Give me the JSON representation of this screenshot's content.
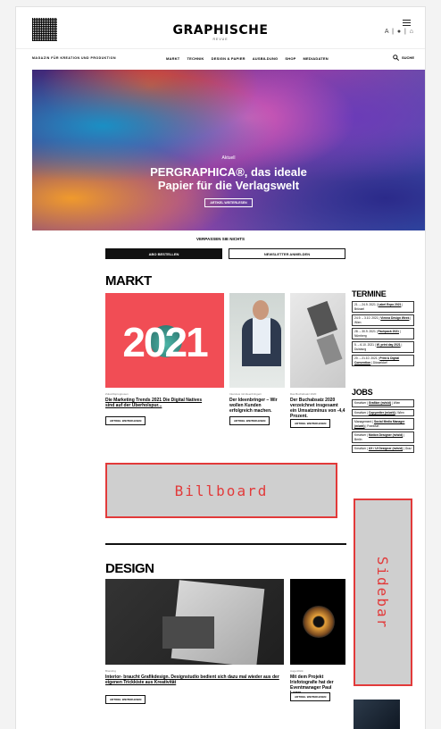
{
  "header": {
    "brand": "GRAPHISCHE",
    "brand_sub": "REVUE",
    "tagline": "MAGAZIN FÜR KREATION UND PRODUKTION",
    "util_icons": "A | ● | ⌂"
  },
  "nav": {
    "items": [
      "MARKT",
      "TECHNIK",
      "DESIGN & PAPIER",
      "AUSBILDUNG",
      "SHOP",
      "MEDIADATEN"
    ],
    "search_label": "SUCHE"
  },
  "hero": {
    "kicker": "Aktuell",
    "title_line1": "PERGRAPHICA®, das ideale",
    "title_line2": "Papier für die Verlagswelt",
    "button": "ARTIKEL WEITERLESEN"
  },
  "promo": {
    "heading": "VERPASSEN SIE NICHTS",
    "abo_button": "ABO BESTELLEN",
    "newsletter_button": "NEWSLETTER ANMELDEN"
  },
  "markt": {
    "title": "MARKT",
    "cards": [
      {
        "meta": "Zukunftsprognosen",
        "headline": "Die Marketing Trends 2021 Die Digital Natives sind auf der Überholspur...",
        "button": "ARTIKEL WEITERLESEN",
        "image_text": "2021"
      },
      {
        "meta": "Interview mit Ideenbringern",
        "headline": "Der Ideenbringer – Wir wollen Kunden erfolgreich machen.",
        "button": "ARTIKEL WEITERLESEN"
      },
      {
        "meta": "Das Buchabsatz 2020",
        "headline": "Der Buchabsatz 2020 verzeichnet insgesamt ein Umsatzminus von -4,4 Prozent.",
        "button": "ARTIKEL WEITERLESEN"
      }
    ]
  },
  "termine": {
    "title": "TERMINE",
    "items": [
      {
        "date": "21. – 24.9. 2021",
        "name": "Label Expo 2021",
        "place": "Brüssel"
      },
      {
        "date": "24.9. – 3.10. 2021",
        "name": "Vienna Design Week",
        "place": "Wien"
      },
      {
        "date": "28. – 30.9. 2021",
        "name": "Fachpack 2021",
        "place": "Nürnberg"
      },
      {
        "date": "5. – 6.10. 2021",
        "name": "W. print day 2021",
        "place": "Duisburg"
      },
      {
        "date": "20. – 21.10. 2021",
        "name": "Print & Digital Convention",
        "place": "Düsseldorf"
      }
    ]
  },
  "jobs": {
    "title": "JOBS",
    "items": [
      {
        "company": "Kreativer",
        "role": "Grafiker (m/w/d)",
        "place": "Wien"
      },
      {
        "company": "Kreativer",
        "role": "Copywriter (m/w/d)",
        "place": "Wien"
      },
      {
        "company": "Management",
        "role": "Social Media Manager (m/w/d)",
        "place": "Frankfurt"
      },
      {
        "company": "Kreativer",
        "role": "Motion Designer (m/w/d)",
        "place": "Berlin"
      },
      {
        "company": "Kreativer",
        "role": "UX / UI Designer (m/w/d)",
        "place": "Graz"
      }
    ]
  },
  "ads": {
    "billboard": "Billboard",
    "sidebar": "Sidebar"
  },
  "design": {
    "title": "DESIGN",
    "cards": [
      {
        "meta": "Branding",
        "headline": "Interior- braucht Grafikdesign. Designstudio bedient sich dazu mal wieder aus der eigenen Trickkiste aus Kreativität",
        "button": "ARTIKEL WEITERLESEN"
      },
      {
        "meta": "Augenblick",
        "headline": "Mit dem Projekt Irisfotografie hat der Eventmanager Paul Lang...",
        "button": "ARTIKEL WEITERLESEN"
      }
    ]
  }
}
